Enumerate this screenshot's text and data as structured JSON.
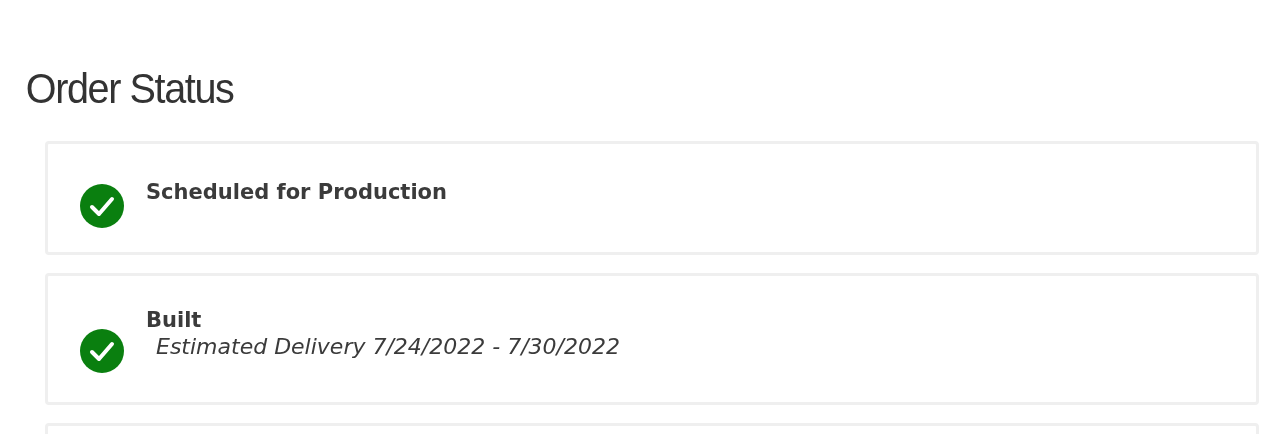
{
  "title": "Order Status",
  "steps": [
    {
      "label": "Scheduled for Production",
      "completed": true
    },
    {
      "label": "Built",
      "detail": "Estimated Delivery 7/24/2022 - 7/30/2022",
      "completed": true
    }
  ]
}
